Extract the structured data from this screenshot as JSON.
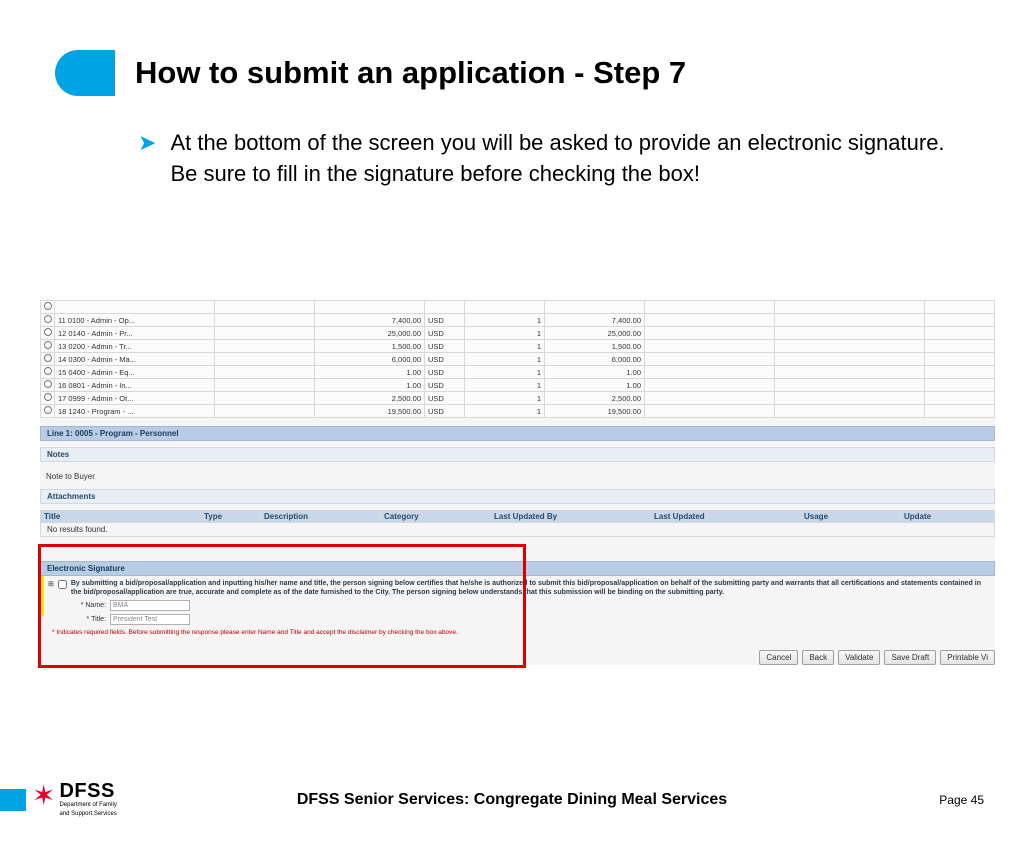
{
  "slide": {
    "title": "How to submit an application - Step 7",
    "bullet": "At the bottom of the screen you will be asked to provide an electronic signature. Be sure to fill in the signature before checking the box!"
  },
  "table": {
    "rows": [
      {
        "desc": "11 0100 - Admin - Op...",
        "amt1": "7,400.00",
        "cur": "USD",
        "qty": "1",
        "amt2": "7,400.00"
      },
      {
        "desc": "12 0140 - Admin - Pr...",
        "amt1": "25,000.00",
        "cur": "USD",
        "qty": "1",
        "amt2": "25,000.00"
      },
      {
        "desc": "13 0200 - Admin - Tr...",
        "amt1": "1,500.00",
        "cur": "USD",
        "qty": "1",
        "amt2": "1,500.00"
      },
      {
        "desc": "14 0300 - Admin - Ma...",
        "amt1": "6,000.00",
        "cur": "USD",
        "qty": "1",
        "amt2": "6,000.00"
      },
      {
        "desc": "15 0400 - Admin - Eq...",
        "amt1": "1.00",
        "cur": "USD",
        "qty": "1",
        "amt2": "1.00"
      },
      {
        "desc": "16 0801 - Admin - In...",
        "amt1": "1.00",
        "cur": "USD",
        "qty": "1",
        "amt2": "1.00"
      },
      {
        "desc": "17 0999 - Admin - Ot...",
        "amt1": "2,500.00",
        "cur": "USD",
        "qty": "1",
        "amt2": "2,500.00"
      },
      {
        "desc": "18 1240 - Program - ...",
        "amt1": "19,500.00",
        "cur": "USD",
        "qty": "1",
        "amt2": "19,500.00"
      }
    ]
  },
  "sections": {
    "line_header": "Line 1: 0005 - Program - Personnel",
    "notes_label": "Notes",
    "note_to_buyer": "Note to Buyer",
    "attachments_label": "Attachments",
    "no_results": "No results found."
  },
  "att_cols": {
    "title": "Title",
    "type": "Type",
    "description": "Description",
    "category": "Category",
    "last_by": "Last Updated By",
    "last": "Last Updated",
    "usage": "Usage",
    "update": "Update"
  },
  "esig": {
    "header": "Electronic Signature",
    "text": "By submitting a bid/proposal/application and inputting his/her name and title, the person signing below certifies that he/she is authorized to submit this bid/proposal/application on behalf of the submitting party and warrants that all certifications and statements contained in the bid/proposal/application are true, accurate and complete as of the date furnished to the City. The person signing below understands that this submission will be binding on the submitting party.",
    "name_label": "* Name:",
    "name_value": "BMA",
    "title_label": "* Title:",
    "title_value": "President Test",
    "req_note": "* Indicates required fields. Before submitting the response please enter Name and Title and accept the disclaimer by checking the box above."
  },
  "buttons": {
    "cancel": "Cancel",
    "back": "Back",
    "validate": "Validate",
    "save": "Save Draft",
    "print": "Printable Vi"
  },
  "footer": {
    "dfss": "DFSS",
    "dept1": "Department of Family",
    "dept2": "and Support Services",
    "title": "DFSS Senior Services: Congregate Dining Meal Services",
    "page": "Page 45"
  }
}
